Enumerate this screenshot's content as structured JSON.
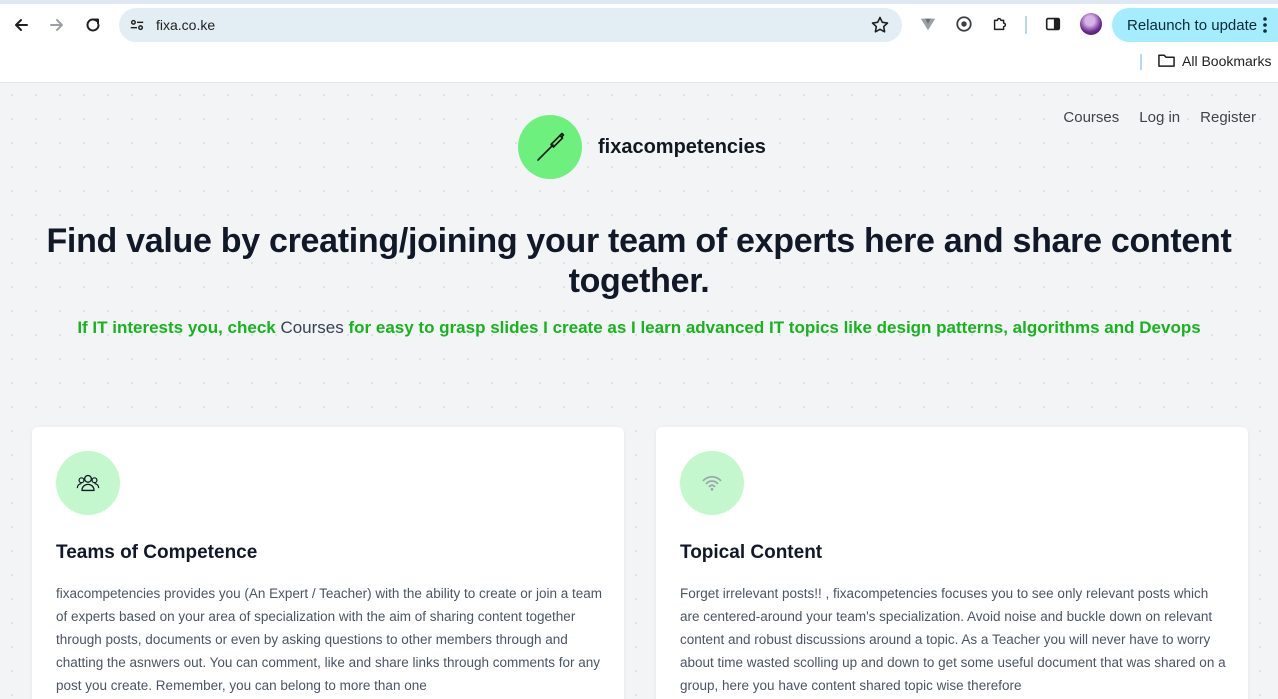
{
  "browser": {
    "url": "fixa.co.ke",
    "relaunch_label": "Relaunch to update",
    "bookmarks_label": "All Bookmarks"
  },
  "nav": {
    "courses": "Courses",
    "login": "Log in",
    "register": "Register"
  },
  "brand": {
    "name": "fixacompetencies",
    "logo_color": "#6ef07f"
  },
  "hero": {
    "title": "Find value by creating/joining your team of experts here and share content together.",
    "subtitle_prefix": "If IT interests you, check ",
    "subtitle_link": "Courses",
    "subtitle_suffix": " for easy to grasp slides I create as I learn advanced IT topics like design patterns, algorithms and Devops",
    "accent_color": "#16b51c"
  },
  "cards": [
    {
      "icon": "users-icon",
      "title": "Teams of Competence",
      "body": "fixacompetencies provides you (An Expert / Teacher) with the ability to create or join a team of experts based on your area of specialization with the aim of sharing content together through posts, documents or even by asking questions to other members through and chatting the asnwers out. You can comment, like and share links through comments for any post you create. Remember, you can belong to more than one"
    },
    {
      "icon": "wifi-icon",
      "title": "Topical Content",
      "body": "Forget irrelevant posts!! , fixacompetencies focuses you to see only relevant posts which are centered-around your team's specialization. Avoid noise and buckle down on relevant content and robust discussions around a topic. As a Teacher you will never have to worry about time wasted scolling up and down to get some useful document that was shared on a group, here you have content shared topic wise therefore"
    }
  ]
}
